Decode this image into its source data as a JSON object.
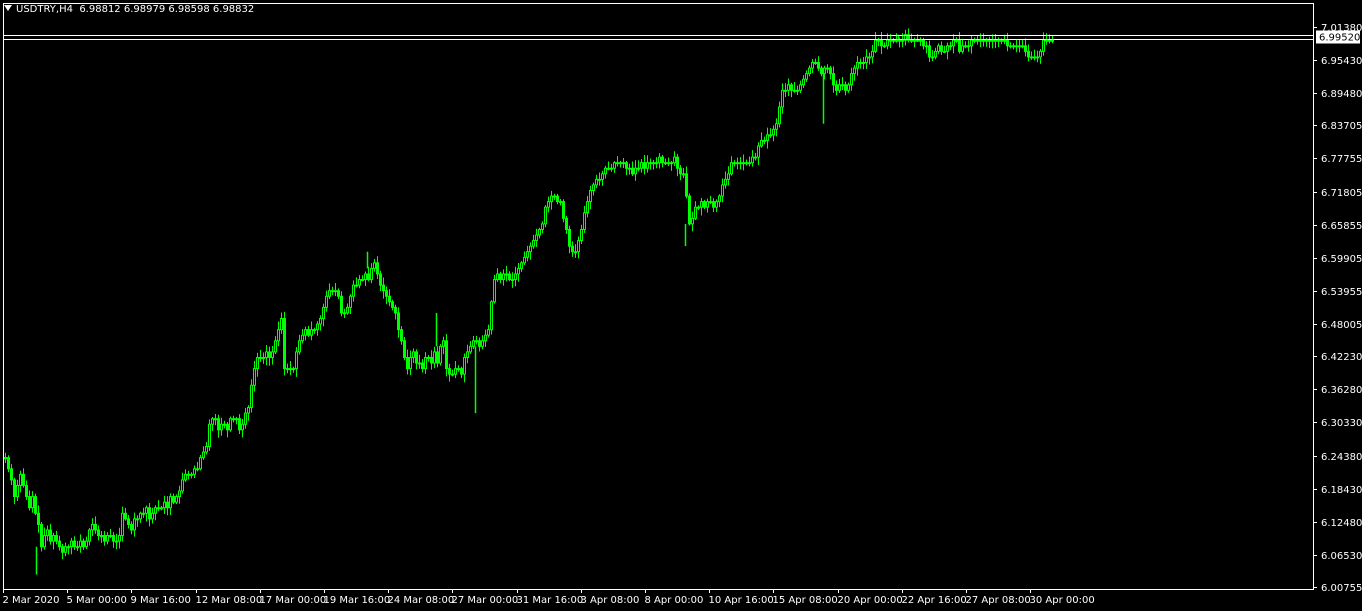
{
  "header": {
    "symbol_timeframe": "USDTRY,H4",
    "ohlc": "6.98812 6.98979 6.98598 6.98832"
  },
  "colors": {
    "background": "#000000",
    "bull_candle": "#00ff00",
    "bear_candle": "#00ff00",
    "axis": "#ffffff",
    "price_line": "#ffffff"
  },
  "chart_data": {
    "type": "candlestick",
    "symbol": "USDTRY",
    "timeframe": "H4",
    "current_price_label": "6.99520",
    "y_ticks": [
      "7.01380",
      "6.95430",
      "6.89480",
      "6.83705",
      "6.77755",
      "6.71805",
      "6.65855",
      "6.59905",
      "6.53955",
      "6.48005",
      "6.42230",
      "6.36280",
      "6.30330",
      "6.24380",
      "6.18430",
      "6.12480",
      "6.06530",
      "6.00755"
    ],
    "ylim": [
      6.00755,
      7.0138
    ],
    "x_ticks": [
      "2 Mar 2020",
      "5 Mar 00:00",
      "9 Mar 16:00",
      "12 Mar 08:00",
      "17 Mar 00:00",
      "19 Mar 16:00",
      "24 Mar 08:00",
      "27 Mar 00:00",
      "31 Mar 16:00",
      "3 Apr 08:00",
      "8 Apr 00:00",
      "10 Apr 16:00",
      "15 Apr 08:00",
      "20 Apr 00:00",
      "22 Apr 16:00",
      "27 Apr 08:00",
      "30 Apr 00:00"
    ],
    "close_path": [
      [
        0,
        6.24
      ],
      [
        3,
        6.22
      ],
      [
        6,
        6.2
      ],
      [
        9,
        6.17
      ],
      [
        12,
        6.19
      ],
      [
        15,
        6.21
      ],
      [
        18,
        6.19
      ],
      [
        21,
        6.17
      ],
      [
        24,
        6.15
      ],
      [
        27,
        6.17
      ],
      [
        30,
        6.14
      ],
      [
        33,
        6.12
      ],
      [
        36,
        6.08
      ],
      [
        39,
        6.1
      ],
      [
        42,
        6.11
      ],
      [
        45,
        6.09
      ],
      [
        48,
        6.1
      ],
      [
        51,
        6.09
      ],
      [
        54,
        6.08
      ],
      [
        57,
        6.07
      ],
      [
        60,
        6.08
      ],
      [
        63,
        6.08
      ],
      [
        66,
        6.09
      ],
      [
        69,
        6.08
      ],
      [
        72,
        6.08
      ],
      [
        75,
        6.09
      ],
      [
        78,
        6.08
      ],
      [
        81,
        6.09
      ],
      [
        84,
        6.11
      ],
      [
        87,
        6.12
      ],
      [
        90,
        6.11
      ],
      [
        93,
        6.1
      ],
      [
        96,
        6.1
      ],
      [
        99,
        6.09
      ],
      [
        102,
        6.1
      ],
      [
        105,
        6.1
      ],
      [
        108,
        6.09
      ],
      [
        111,
        6.09
      ],
      [
        114,
        6.1
      ],
      [
        117,
        6.14
      ],
      [
        120,
        6.13
      ],
      [
        123,
        6.12
      ],
      [
        126,
        6.11
      ],
      [
        129,
        6.13
      ],
      [
        132,
        6.13
      ],
      [
        135,
        6.14
      ],
      [
        138,
        6.14
      ],
      [
        141,
        6.15
      ],
      [
        144,
        6.13
      ],
      [
        147,
        6.14
      ],
      [
        150,
        6.15
      ],
      [
        153,
        6.15
      ],
      [
        156,
        6.15
      ],
      [
        159,
        6.16
      ],
      [
        162,
        6.15
      ],
      [
        165,
        6.17
      ],
      [
        168,
        6.16
      ],
      [
        171,
        6.17
      ],
      [
        174,
        6.18
      ],
      [
        177,
        6.2
      ],
      [
        180,
        6.21
      ],
      [
        183,
        6.21
      ],
      [
        186,
        6.21
      ],
      [
        189,
        6.22
      ],
      [
        192,
        6.22
      ],
      [
        195,
        6.24
      ],
      [
        198,
        6.25
      ],
      [
        201,
        6.26
      ],
      [
        204,
        6.3
      ],
      [
        207,
        6.31
      ],
      [
        210,
        6.31
      ],
      [
        213,
        6.29
      ],
      [
        216,
        6.3
      ],
      [
        219,
        6.3
      ],
      [
        222,
        6.29
      ],
      [
        225,
        6.31
      ],
      [
        228,
        6.31
      ],
      [
        231,
        6.31
      ],
      [
        234,
        6.29
      ],
      [
        237,
        6.3
      ],
      [
        240,
        6.32
      ],
      [
        243,
        6.33
      ],
      [
        246,
        6.37
      ],
      [
        249,
        6.4
      ],
      [
        252,
        6.42
      ],
      [
        255,
        6.42
      ],
      [
        258,
        6.42
      ],
      [
        261,
        6.43
      ],
      [
        264,
        6.42
      ],
      [
        267,
        6.43
      ],
      [
        270,
        6.45
      ],
      [
        273,
        6.47
      ],
      [
        276,
        6.49
      ],
      [
        279,
        6.4
      ],
      [
        282,
        6.4
      ],
      [
        285,
        6.4
      ],
      [
        288,
        6.4
      ],
      [
        291,
        6.43
      ],
      [
        294,
        6.45
      ],
      [
        297,
        6.46
      ],
      [
        300,
        6.47
      ],
      [
        303,
        6.46
      ],
      [
        306,
        6.47
      ],
      [
        309,
        6.47
      ],
      [
        312,
        6.48
      ],
      [
        315,
        6.49
      ],
      [
        318,
        6.51
      ],
      [
        321,
        6.53
      ],
      [
        324,
        6.54
      ],
      [
        327,
        6.54
      ],
      [
        330,
        6.54
      ],
      [
        333,
        6.53
      ],
      [
        336,
        6.5
      ],
      [
        339,
        6.5
      ],
      [
        342,
        6.51
      ],
      [
        345,
        6.53
      ],
      [
        348,
        6.55
      ],
      [
        351,
        6.55
      ],
      [
        354,
        6.56
      ],
      [
        357,
        6.56
      ],
      [
        360,
        6.57
      ],
      [
        363,
        6.56
      ],
      [
        366,
        6.58
      ],
      [
        369,
        6.59
      ],
      [
        372,
        6.57
      ],
      [
        375,
        6.55
      ],
      [
        378,
        6.54
      ],
      [
        381,
        6.53
      ],
      [
        384,
        6.52
      ],
      [
        387,
        6.51
      ],
      [
        390,
        6.5
      ],
      [
        393,
        6.47
      ],
      [
        396,
        6.45
      ],
      [
        399,
        6.42
      ],
      [
        402,
        6.4
      ],
      [
        405,
        6.42
      ],
      [
        408,
        6.43
      ],
      [
        411,
        6.41
      ],
      [
        414,
        6.41
      ],
      [
        417,
        6.4
      ],
      [
        420,
        6.42
      ],
      [
        423,
        6.42
      ],
      [
        426,
        6.41
      ],
      [
        429,
        6.43
      ],
      [
        432,
        6.41
      ],
      [
        435,
        6.44
      ],
      [
        438,
        6.45
      ],
      [
        441,
        6.4
      ],
      [
        444,
        6.39
      ],
      [
        447,
        6.39
      ],
      [
        450,
        6.4
      ],
      [
        453,
        6.4
      ],
      [
        456,
        6.39
      ],
      [
        459,
        6.42
      ],
      [
        462,
        6.43
      ],
      [
        465,
        6.44
      ],
      [
        468,
        6.45
      ],
      [
        471,
        6.45
      ],
      [
        474,
        6.44
      ],
      [
        477,
        6.45
      ],
      [
        480,
        6.46
      ],
      [
        483,
        6.47
      ],
      [
        486,
        6.52
      ],
      [
        489,
        6.56
      ],
      [
        492,
        6.57
      ],
      [
        495,
        6.56
      ],
      [
        498,
        6.57
      ],
      [
        501,
        6.57
      ],
      [
        504,
        6.56
      ],
      [
        507,
        6.56
      ],
      [
        510,
        6.57
      ],
      [
        513,
        6.58
      ],
      [
        516,
        6.59
      ],
      [
        519,
        6.6
      ],
      [
        522,
        6.61
      ],
      [
        525,
        6.62
      ],
      [
        528,
        6.63
      ],
      [
        531,
        6.64
      ],
      [
        534,
        6.65
      ],
      [
        537,
        6.66
      ],
      [
        540,
        6.69
      ],
      [
        543,
        6.7
      ],
      [
        546,
        6.71
      ],
      [
        549,
        6.71
      ],
      [
        552,
        6.7
      ],
      [
        555,
        6.7
      ],
      [
        558,
        6.67
      ],
      [
        561,
        6.65
      ],
      [
        564,
        6.62
      ],
      [
        567,
        6.61
      ],
      [
        570,
        6.61
      ],
      [
        573,
        6.63
      ],
      [
        576,
        6.65
      ],
      [
        579,
        6.68
      ],
      [
        582,
        6.7
      ],
      [
        585,
        6.72
      ],
      [
        588,
        6.73
      ],
      [
        591,
        6.74
      ],
      [
        594,
        6.74
      ],
      [
        597,
        6.75
      ],
      [
        600,
        6.76
      ],
      [
        603,
        6.76
      ],
      [
        606,
        6.76
      ],
      [
        609,
        6.77
      ],
      [
        612,
        6.77
      ],
      [
        615,
        6.77
      ],
      [
        618,
        6.77
      ],
      [
        621,
        6.76
      ],
      [
        624,
        6.76
      ],
      [
        627,
        6.75
      ],
      [
        630,
        6.76
      ],
      [
        633,
        6.76
      ],
      [
        636,
        6.77
      ],
      [
        639,
        6.76
      ],
      [
        642,
        6.77
      ],
      [
        645,
        6.77
      ],
      [
        648,
        6.77
      ],
      [
        651,
        6.77
      ],
      [
        654,
        6.78
      ],
      [
        657,
        6.77
      ],
      [
        660,
        6.77
      ],
      [
        663,
        6.77
      ],
      [
        666,
        6.77
      ],
      [
        669,
        6.78
      ],
      [
        672,
        6.76
      ],
      [
        675,
        6.75
      ],
      [
        678,
        6.75
      ],
      [
        681,
        6.71
      ],
      [
        684,
        6.66
      ],
      [
        687,
        6.67
      ],
      [
        690,
        6.69
      ],
      [
        693,
        6.69
      ],
      [
        696,
        6.7
      ],
      [
        699,
        6.69
      ],
      [
        702,
        6.7
      ],
      [
        705,
        6.7
      ],
      [
        708,
        6.69
      ],
      [
        711,
        6.7
      ],
      [
        714,
        6.71
      ],
      [
        717,
        6.73
      ],
      [
        720,
        6.74
      ],
      [
        723,
        6.75
      ],
      [
        726,
        6.77
      ],
      [
        729,
        6.77
      ],
      [
        732,
        6.77
      ],
      [
        735,
        6.77
      ],
      [
        738,
        6.77
      ],
      [
        741,
        6.77
      ],
      [
        744,
        6.77
      ],
      [
        747,
        6.78
      ],
      [
        750,
        6.78
      ],
      [
        753,
        6.8
      ],
      [
        756,
        6.81
      ],
      [
        759,
        6.81
      ],
      [
        762,
        6.82
      ],
      [
        765,
        6.82
      ],
      [
        768,
        6.83
      ],
      [
        771,
        6.84
      ],
      [
        774,
        6.87
      ],
      [
        777,
        6.9
      ],
      [
        780,
        6.9
      ],
      [
        783,
        6.91
      ],
      [
        786,
        6.9
      ],
      [
        789,
        6.9
      ],
      [
        792,
        6.9
      ],
      [
        795,
        6.91
      ],
      [
        798,
        6.92
      ],
      [
        801,
        6.93
      ],
      [
        804,
        6.94
      ],
      [
        807,
        6.95
      ],
      [
        810,
        6.95
      ],
      [
        813,
        6.94
      ],
      [
        816,
        6.93
      ],
      [
        819,
        6.94
      ],
      [
        822,
        6.94
      ],
      [
        825,
        6.93
      ],
      [
        828,
        6.91
      ],
      [
        831,
        6.9
      ],
      [
        834,
        6.91
      ],
      [
        837,
        6.91
      ],
      [
        840,
        6.9
      ],
      [
        843,
        6.91
      ],
      [
        846,
        6.93
      ],
      [
        849,
        6.94
      ],
      [
        852,
        6.95
      ],
      [
        855,
        6.95
      ],
      [
        858,
        6.95
      ],
      [
        861,
        6.96
      ],
      [
        864,
        6.96
      ],
      [
        867,
        6.97
      ],
      [
        870,
        6.99
      ],
      [
        873,
        6.99
      ],
      [
        876,
        6.98
      ],
      [
        879,
        6.98
      ],
      [
        882,
        6.99
      ],
      [
        885,
        6.99
      ],
      [
        888,
        6.99
      ],
      [
        891,
        6.99
      ],
      [
        894,
        6.99
      ],
      [
        897,
        6.99
      ],
      [
        900,
        7.0
      ],
      [
        903,
        6.99
      ],
      [
        906,
        6.99
      ],
      [
        909,
        6.99
      ],
      [
        912,
        6.99
      ],
      [
        915,
        6.99
      ],
      [
        918,
        6.98
      ],
      [
        921,
        6.98
      ],
      [
        924,
        6.96
      ],
      [
        927,
        6.96
      ],
      [
        930,
        6.97
      ],
      [
        933,
        6.98
      ],
      [
        936,
        6.97
      ],
      [
        939,
        6.97
      ],
      [
        942,
        6.98
      ],
      [
        945,
        6.98
      ],
      [
        948,
        6.99
      ],
      [
        951,
        6.99
      ],
      [
        954,
        6.97
      ],
      [
        957,
        6.98
      ],
      [
        960,
        6.98
      ],
      [
        963,
        6.98
      ],
      [
        966,
        6.99
      ],
      [
        969,
        6.99
      ],
      [
        972,
        6.99
      ],
      [
        975,
        6.99
      ],
      [
        978,
        6.99
      ],
      [
        981,
        6.99
      ],
      [
        984,
        6.99
      ],
      [
        987,
        6.99
      ],
      [
        990,
        6.99
      ],
      [
        993,
        6.99
      ],
      [
        996,
        6.99
      ],
      [
        999,
        6.99
      ],
      [
        1002,
        6.98
      ],
      [
        1005,
        6.98
      ],
      [
        1008,
        6.98
      ],
      [
        1011,
        6.98
      ],
      [
        1014,
        6.98
      ],
      [
        1017,
        6.98
      ],
      [
        1020,
        6.97
      ],
      [
        1023,
        6.96
      ],
      [
        1026,
        6.96
      ],
      [
        1029,
        6.96
      ],
      [
        1032,
        6.96
      ],
      [
        1035,
        6.97
      ],
      [
        1038,
        6.99
      ],
      [
        1041,
        6.99
      ],
      [
        1044,
        6.99
      ],
      [
        1047,
        6.99
      ]
    ],
    "spikes": [
      {
        "x": 36,
        "low": 6.03
      },
      {
        "x": 475,
        "low": 6.32
      },
      {
        "x": 685,
        "low": 6.62
      },
      {
        "x": 823,
        "low": 6.84
      },
      {
        "x": 367,
        "high": 6.61
      },
      {
        "x": 436,
        "high": 6.5
      },
      {
        "x": 898,
        "high": 7.0
      }
    ]
  }
}
